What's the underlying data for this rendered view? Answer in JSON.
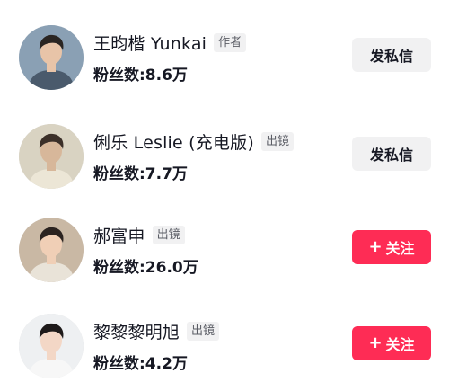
{
  "users": [
    {
      "name": "王昀楷 Yunkai",
      "role": "作者",
      "fans": "粉丝数:8.6万",
      "action": {
        "type": "message",
        "label": "发私信"
      },
      "avatar": {
        "icon": "avatar-man-outdoor",
        "bg": "#8aa0b4",
        "skin": "#e8c4a8",
        "hair": "#2a2522",
        "shirt": "#4a5a6c"
      }
    },
    {
      "name": "俐乐 Leslie (充电版)",
      "role": "出镜",
      "fans": "粉丝数:7.7万",
      "action": {
        "type": "message",
        "label": "发私信"
      },
      "avatar": {
        "icon": "avatar-child-vintage",
        "bg": "#d9d3c2",
        "skin": "#d7b79a",
        "hair": "#3b2f28",
        "shirt": "#ece6d6"
      }
    },
    {
      "name": "郝富申",
      "role": "出镜",
      "fans": "粉丝数:26.0万",
      "action": {
        "type": "follow",
        "icon": "plus-icon",
        "label": "关注"
      },
      "avatar": {
        "icon": "avatar-man-smile",
        "bg": "#c9b8a4",
        "skin": "#f0cfb6",
        "hair": "#2b2320",
        "shirt": "#e9e3d8"
      }
    },
    {
      "name": "黎黎黎明旭",
      "role": "出镜",
      "fans": "粉丝数:4.2万",
      "action": {
        "type": "follow",
        "icon": "plus-icon",
        "label": "关注"
      },
      "avatar": {
        "icon": "avatar-man-portrait",
        "bg": "#eef0f2",
        "skin": "#f3d7c6",
        "hair": "#1e1a1a",
        "shirt": "#f7f7f7"
      }
    }
  ],
  "colors": {
    "follow_button": "#fe2c55",
    "message_button": "#f1f1f2",
    "badge_bg": "#f1f1f2",
    "text_primary": "#161823"
  }
}
